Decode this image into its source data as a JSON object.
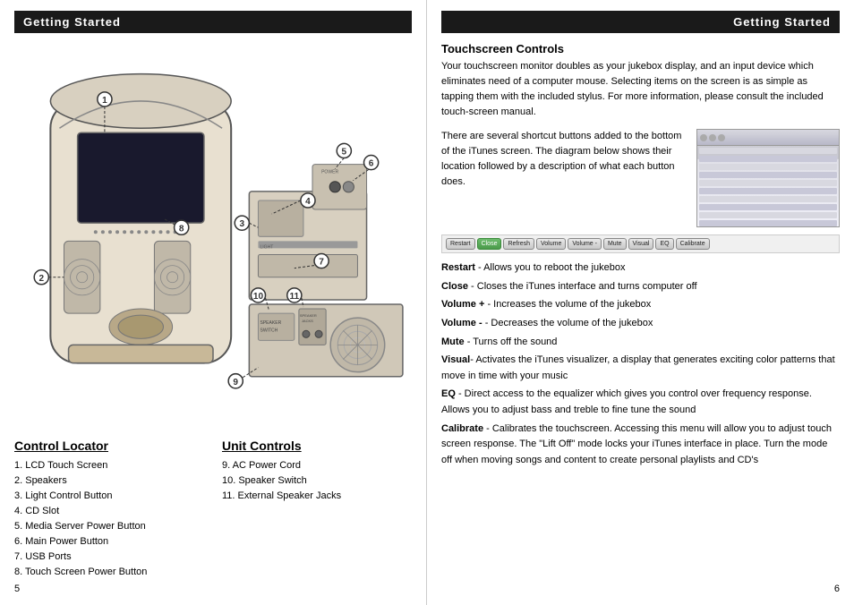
{
  "left": {
    "header": "Getting Started",
    "control_locator": {
      "title": "Control Locator",
      "items": [
        "1.  LCD Touch Screen",
        "2.  Speakers",
        "3.  Light Control Button",
        "4.  CD Slot",
        "5.  Media Server Power Button",
        "6.  Main Power Button",
        "7.  USB Ports",
        "8.  Touch Screen Power Button"
      ]
    },
    "unit_controls": {
      "title": "Unit Controls",
      "items": [
        "9.  AC Power Cord",
        "10.  Speaker Switch",
        "11.  External Speaker Jacks"
      ]
    },
    "page_number": "5"
  },
  "right": {
    "header": "Getting Started",
    "touchscreen_title": "Touchscreen Controls",
    "touchscreen_body": "Your touchscreen monitor doubles as your jukebox display, and an input device which eliminates need of a computer mouse.  Selecting items on the screen is as simple as tapping them with the included stylus.  For more information, please consult the included touch-screen manual.",
    "itunes_text": "There are several shortcut buttons added to the bottom of the iTunes screen.  The diagram below shows their location followed by a description of what each button does.",
    "buttons": [
      {
        "label": "Restart",
        "style": "normal"
      },
      {
        "label": "Close",
        "style": "green"
      },
      {
        "label": "Refresh",
        "style": "normal"
      },
      {
        "label": "Volume",
        "style": "normal"
      },
      {
        "label": "Volume -",
        "style": "normal"
      },
      {
        "label": "Mute",
        "style": "normal"
      },
      {
        "label": "Visual",
        "style": "normal"
      },
      {
        "label": "EQ",
        "style": "normal"
      },
      {
        "label": "Calibrate",
        "style": "normal"
      }
    ],
    "descriptions": [
      {
        "label": "Restart",
        "text": " - Allows you to reboot the jukebox"
      },
      {
        "label": "Close",
        "text": " - Closes the iTunes interface and turns computer off"
      },
      {
        "label": "Volume +",
        "text": " - Increases the volume of the jukebox"
      },
      {
        "label": "Volume -",
        "text": " - Decreases the volume of the jukebox"
      },
      {
        "label": "Mute",
        "text": " - Turns off the sound"
      },
      {
        "label": "Visual",
        "text": "- Activates the iTunes visualizer, a display that generates exciting color patterns that move in time with your music"
      },
      {
        "label": "EQ",
        "text": " - Direct access to the equalizer which gives you control over frequency response.  Allows you to adjust bass and treble to fine tune the sound"
      },
      {
        "label": "Calibrate",
        "text": " - Calibrates the touchscreen.  Accessing this menu will allow you to adjust touch screen response.  The \"Lift Off\" mode locks your iTunes interface in place.  Turn the mode off when moving songs and content to create personal playlists and CD's"
      }
    ],
    "page_number": "6"
  }
}
